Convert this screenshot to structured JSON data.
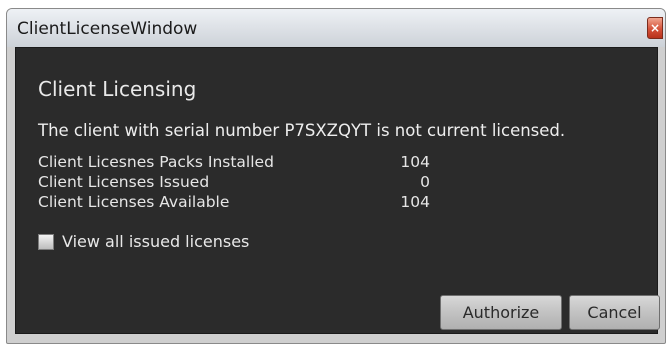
{
  "window": {
    "title": "ClientLicenseWindow",
    "close_glyph": "×"
  },
  "dialog": {
    "heading": "Client Licensing",
    "message": "The client with serial number P7SXZQYT is not current licensed.",
    "stats": [
      {
        "label": "Client Licesnes Packs Installed",
        "value": "104"
      },
      {
        "label": "Client Licenses Issued",
        "value": "0"
      },
      {
        "label": "Client Licenses Available",
        "value": "104"
      }
    ],
    "checkbox": {
      "label": "View all issued licenses",
      "checked": false
    }
  },
  "buttons": {
    "authorize": "Authorize",
    "cancel": "Cancel"
  },
  "colors": {
    "panel_background": "#2b2b2b",
    "text": "#e9e9e9",
    "close_button": "#c9412a"
  }
}
